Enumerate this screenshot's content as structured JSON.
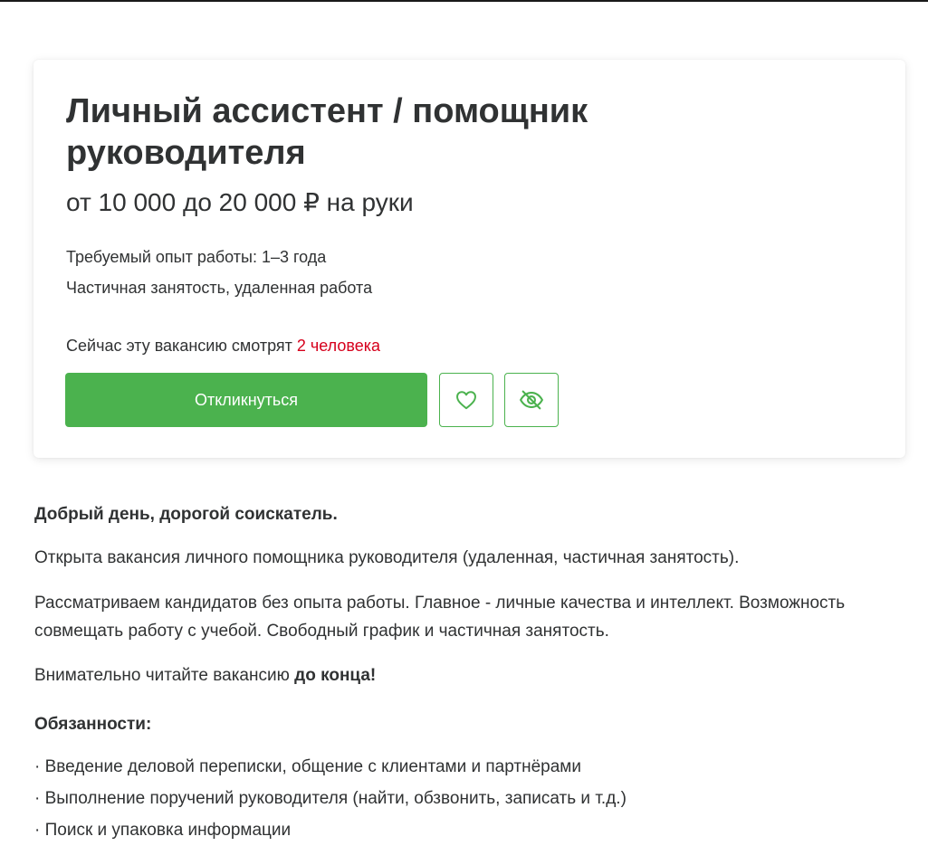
{
  "vacancy": {
    "title": "Личный ассистент / помощник руководителя",
    "salary": "от 10 000 до 20 000 ₽ на руки",
    "experience": "Требуемый опыт работы: 1–3 года",
    "employment": "Частичная занятость, удаленная работа",
    "viewers_prefix": "Сейчас эту вакансию смотрят ",
    "viewers_count": "2 человека",
    "respond_label": "Откликнуться"
  },
  "icons": {
    "favorite": "heart-icon",
    "hide": "eye-off-icon"
  },
  "colors": {
    "accent": "#4bb24e",
    "viewers_count": "#d6001c",
    "text": "#303233"
  },
  "description": {
    "greeting": "Добрый день, дорогой соискатель.",
    "intro": "Открыта вакансия личного помощника руководителя (удаленная, частичная занятость).",
    "candidates": "Рассматриваем кандидатов без опыта работы. Главное - личные качества и интеллект. Возможность совмещать работу с учебой. Свободный график и частичная занятость.",
    "read_prefix": "Внимательно читайте вакансию ",
    "read_bold": "до конца!",
    "duties_heading": "Обязанности:",
    "duties": [
      "· Введение деловой переписки, общение с клиентами и партнёрами",
      "· Выполнение поручений руководителя (найти, обзвонить, записать и т.д.)",
      "· Поиск и упаковка информации"
    ]
  }
}
